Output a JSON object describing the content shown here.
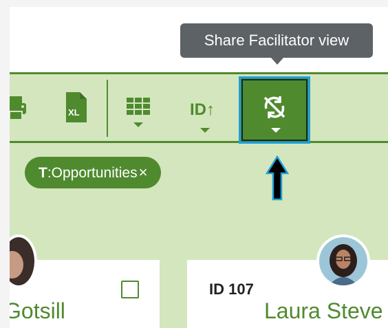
{
  "tooltip": {
    "text": "Share Facilitator view"
  },
  "toolbar": {
    "print": {
      "icon": "printer-icon"
    },
    "excel": {
      "icon": "excel-xl-icon",
      "label": "XL"
    },
    "grid": {
      "icon": "grid-view-icon"
    },
    "sort": {
      "label": "ID↑"
    },
    "share": {
      "icon": "sync-off-icon"
    }
  },
  "filter_chip": {
    "prefix": "T",
    "label": ":Opportunities",
    "remove": "×"
  },
  "cards": [
    {
      "name": "Gotsill"
    },
    {
      "id": "ID 107",
      "name": "Laura Steve"
    }
  ],
  "colors": {
    "accent": "#4f8a2f",
    "background": "#d4e6bd",
    "highlight": "#1fa0d8"
  }
}
